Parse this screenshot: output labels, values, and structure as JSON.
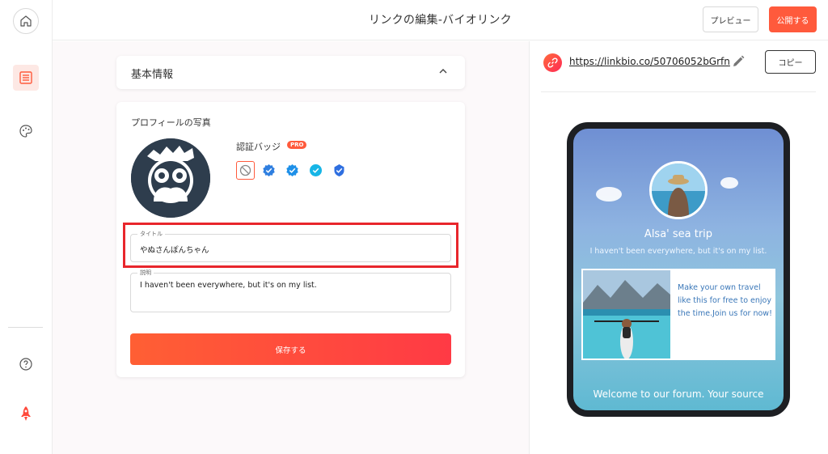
{
  "header": {
    "title": "リンクの編集-バイオリンク",
    "preview_label": "プレビュー",
    "publish_label": "公開する"
  },
  "sidebar": {
    "items": [
      {
        "icon": "home-icon"
      },
      {
        "icon": "editor-icon",
        "active": true
      },
      {
        "icon": "palette-icon"
      },
      {
        "icon": "help-icon"
      },
      {
        "icon": "rocket-icon"
      }
    ]
  },
  "editor": {
    "basic_info_label": "基本情報",
    "profile_photo_label": "プロフィールの写真",
    "verification_badge_label": "認証バッジ",
    "pro_tag": "PRO",
    "title_field": {
      "label": "タイトル",
      "value": "やぬさんぽんちゃん"
    },
    "description_field": {
      "label": "説明",
      "value": "I haven't been everywhere, but it's on my list."
    },
    "save_label": "保存する"
  },
  "preview": {
    "url": "https://linkbio.co/50706052bGrfn",
    "copy_label": "コピー",
    "phone": {
      "name": "Alsa' sea trip",
      "description": "I haven't been everywhere, but it's on my list.",
      "card_text": "Make your own travel like this for free to enjoy the time.Join us for now!",
      "footer": "Welcome to our forum. Your source"
    }
  },
  "colors": {
    "accent": "#ff5a3c",
    "highlight": "#e8262c",
    "badge_blue": "#2f7fe0",
    "badge_cyan": "#17b5e6"
  }
}
